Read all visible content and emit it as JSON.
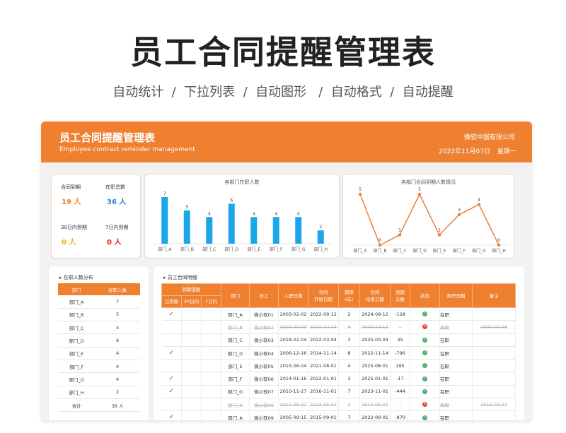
{
  "hero": {
    "title": "员工合同提醒管理表",
    "subtitle": "自动统计  /  下拉列表  /  自动图形   /  自动格式  /  自动提醒"
  },
  "banner": {
    "title": "员工合同提醒管理表",
    "subtitle": "Employee contract reminder management",
    "company": "微软中国有限公司",
    "date": "2022年11月07日",
    "weekday": "星期一"
  },
  "stats": {
    "contract_due_label": "合同到期",
    "contract_due_value": "19 人",
    "total_label": "在职总数",
    "total_value": "36 人",
    "due30_label": "30日内到期",
    "due30_value": "0 人",
    "due7_label": "7日内到期",
    "due7_value": "0 人"
  },
  "colors": {
    "accent": "#ee8030",
    "bar": "#1aa6e8",
    "line": "#e8833a",
    "orange_text": "#ee8030",
    "blue_text": "#2f7fd8",
    "yellow_text": "#f0b400",
    "red_text": "#e02020"
  },
  "chart_data": [
    {
      "type": "bar",
      "title": "各部门在职人数",
      "categories": [
        "部门_A",
        "部门_B",
        "部门_C",
        "部门_D",
        "部门_E",
        "部门_F",
        "部门_G",
        "部门_H"
      ],
      "values": [
        7,
        5,
        4,
        6,
        4,
        4,
        4,
        2
      ],
      "ylim": [
        0,
        7
      ]
    },
    {
      "type": "line",
      "title": "各部门合同到期人数情况",
      "categories": [
        "部门_A",
        "部门_B",
        "部门_C",
        "部门_D",
        "部门_E",
        "部门_F",
        "部门_G",
        "部门_H"
      ],
      "values": [
        5,
        0,
        1,
        5,
        1,
        3,
        4,
        0
      ],
      "ylim": [
        0,
        5
      ]
    }
  ],
  "dept_section": {
    "title": "在职人数分布",
    "headers": [
      "部门",
      "在职人数"
    ],
    "rows": [
      [
        "部门_A",
        "7"
      ],
      [
        "部门_B",
        "5"
      ],
      [
        "部门_C",
        "4"
      ],
      [
        "部门_D",
        "6"
      ],
      [
        "部门_E",
        "4"
      ],
      [
        "部门_F",
        "4"
      ],
      [
        "部门_G",
        "4"
      ],
      [
        "部门_H",
        "2"
      ]
    ],
    "total_label": "合计",
    "total_value": "36 人"
  },
  "detail_section": {
    "title": "员工合同明细",
    "headers": {
      "reminder": "到期提醒",
      "expired": "已到期",
      "within30": "30日内",
      "within7": "7日内",
      "dept": "部门",
      "employee": "员工",
      "hire_date": "入职日期",
      "contract_start": "合同\n开始日期",
      "term": "期限\n(年)",
      "contract_end": "合同\n结束日期",
      "days_left": "到期\n天数",
      "status": "状态",
      "leave_date": "离职日期",
      "note": "备注"
    },
    "rows": [
      {
        "expired": true,
        "dept": "部门_A",
        "emp": "微小软01",
        "hire": "2003-02-02",
        "start": "2022-09-12",
        "term": "2",
        "end": "2024-09-12",
        "days": "-128",
        "ok": true,
        "status": "在职",
        "leave": "",
        "struck": false
      },
      {
        "expired": false,
        "dept": "部门_B",
        "emp": "微小软02",
        "hire": "2010-02-03",
        "start": "2021-12-12",
        "term": "3",
        "end": "2024-12-12",
        "days": "-",
        "ok": false,
        "status": "离职",
        "leave": "2020-02-03",
        "struck": true
      },
      {
        "expired": false,
        "dept": "部门_C",
        "emp": "微小软03",
        "hire": "2018-02-04",
        "start": "2022-03-04",
        "term": "3",
        "end": "2025-03-04",
        "days": "45",
        "ok": true,
        "status": "在职",
        "leave": "",
        "struck": false
      },
      {
        "expired": true,
        "dept": "部门_D",
        "emp": "微小软04",
        "hire": "2006-12-16",
        "start": "2014-11-14",
        "term": "8",
        "end": "2022-11-14",
        "days": "-796",
        "ok": true,
        "status": "在职",
        "leave": "",
        "struck": false
      },
      {
        "expired": false,
        "dept": "部门_E",
        "emp": "微小软05",
        "hire": "2015-08-04",
        "start": "2021-08-01",
        "term": "4",
        "end": "2025-08-01",
        "days": "195",
        "ok": true,
        "status": "在职",
        "leave": "",
        "struck": false
      },
      {
        "expired": true,
        "dept": "部门_F",
        "emp": "微小软06",
        "hire": "2014-01-16",
        "start": "2022-01-01",
        "term": "3",
        "end": "2025-01-01",
        "days": "-17",
        "ok": true,
        "status": "在职",
        "leave": "",
        "struck": false
      },
      {
        "expired": true,
        "dept": "部门_G",
        "emp": "微小软07",
        "hire": "2010-11-27",
        "start": "2016-11-01",
        "term": "7",
        "end": "2023-11-01",
        "days": "-444",
        "ok": true,
        "status": "在职",
        "leave": "",
        "struck": false
      },
      {
        "expired": false,
        "dept": "部门_H",
        "emp": "微小软08",
        "hire": "2012-06-02",
        "start": "2013-06-01",
        "term": "4",
        "end": "2017-06-01",
        "days": "-",
        "ok": false,
        "status": "离职",
        "leave": "2016-03-04",
        "struck": true
      },
      {
        "expired": true,
        "dept": "部门_A",
        "emp": "微小软09",
        "hire": "2005-09-15",
        "start": "2015-09-01",
        "term": "7",
        "end": "2022-09-01",
        "days": "-870",
        "ok": true,
        "status": "在职",
        "leave": "",
        "struck": false
      }
    ]
  },
  "icons": {
    "check": "✓",
    "ok": "✓",
    "bad": "✕"
  }
}
